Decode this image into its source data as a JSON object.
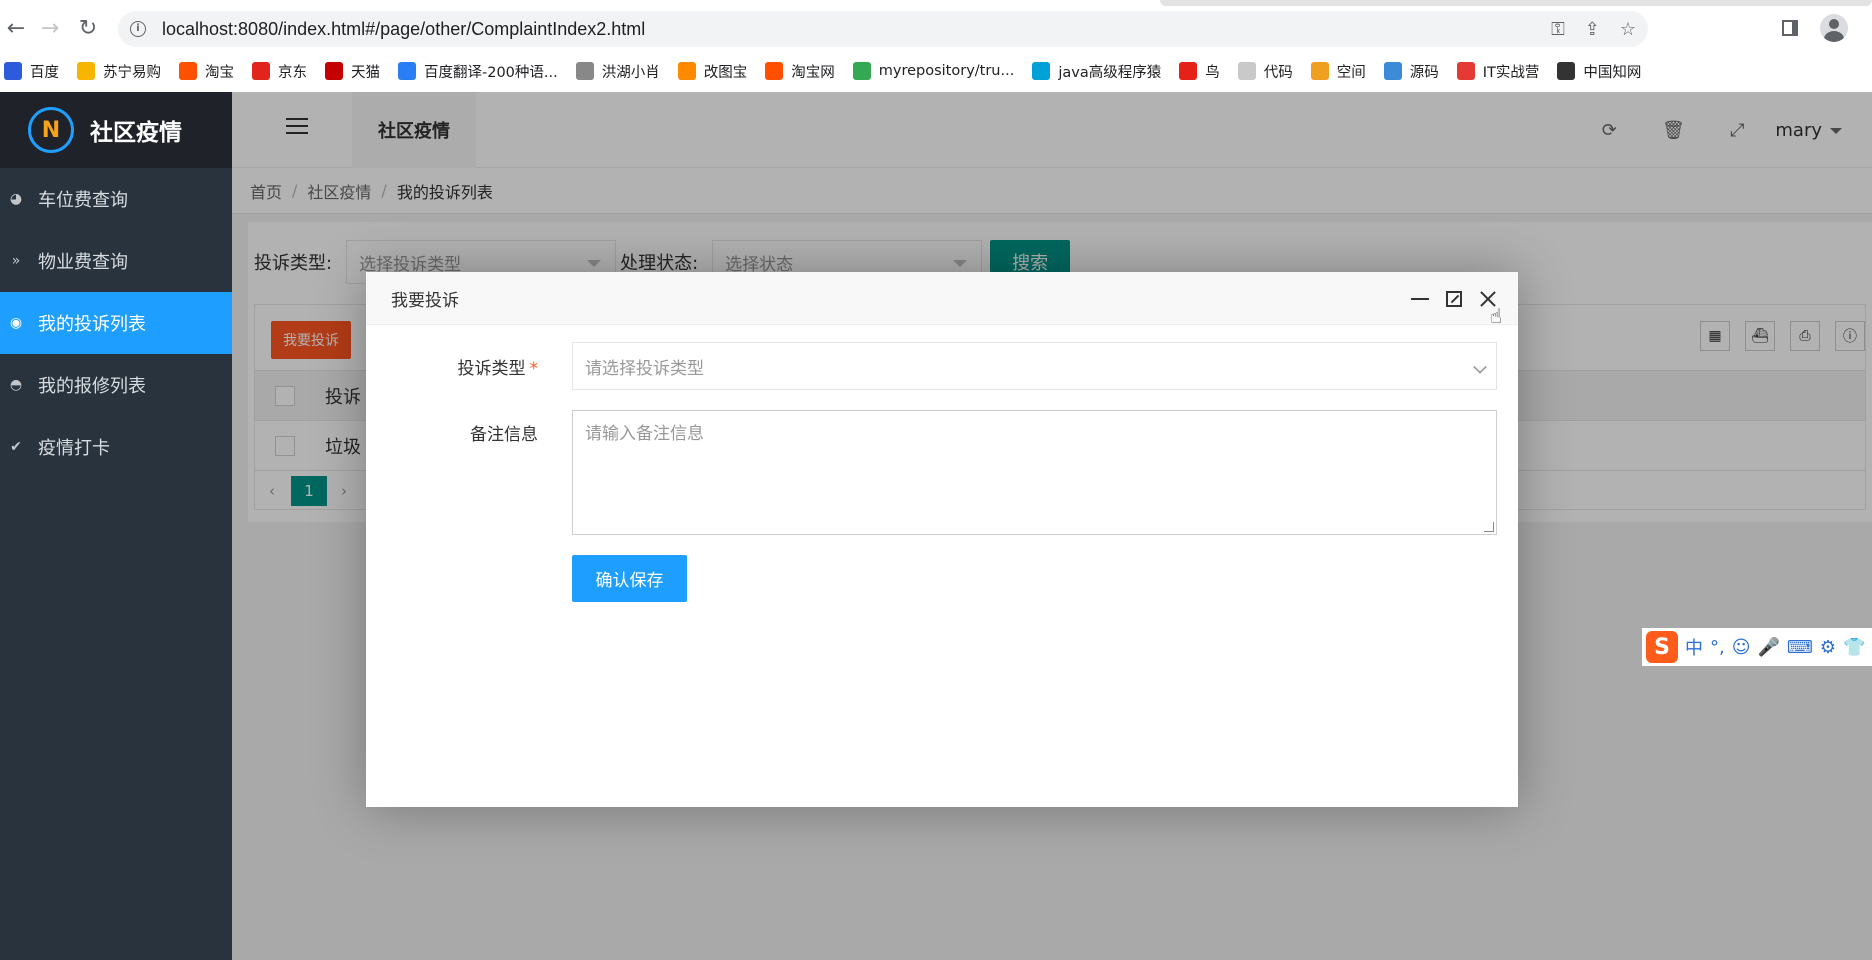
{
  "browser": {
    "url": "localhost:8080/index.html#/page/other/ComplaintIndex2.html",
    "bookmarks": [
      {
        "label": "百度",
        "color": "#2e5bdc",
        "icon": "paw-icon"
      },
      {
        "label": "苏宁易购",
        "color": "#f7b500",
        "icon": "lion-icon"
      },
      {
        "label": "淘宝",
        "color": "#ff5000",
        "icon": "taobao-icon"
      },
      {
        "label": "京东",
        "color": "#e1251b",
        "icon": "jd-icon"
      },
      {
        "label": "天猫",
        "color": "#c40000",
        "icon": "tmall-icon"
      },
      {
        "label": "百度翻译-200种语...",
        "color": "#2a7ef5",
        "icon": "translate-icon"
      },
      {
        "label": "洪湖小肖",
        "color": "#888888",
        "icon": "bird-icon"
      },
      {
        "label": "改图宝",
        "color": "#ff8a00",
        "icon": "image-icon"
      },
      {
        "label": "淘宝网",
        "color": "#ff5000",
        "icon": "taobao-icon"
      },
      {
        "label": "myrepository/tru...",
        "color": "#34a853",
        "icon": "chrome-icon"
      },
      {
        "label": "java高级程序猿",
        "color": "#00a1d6",
        "icon": "tv-icon"
      },
      {
        "label": "鸟",
        "color": "#e62117",
        "icon": "bird-icon"
      },
      {
        "label": "代码",
        "color": "#c9c9c9",
        "icon": "code-icon"
      },
      {
        "label": "空间",
        "color": "#f0a020",
        "icon": "space-icon"
      },
      {
        "label": "源码",
        "color": "#3b8bd9",
        "icon": "fish-icon"
      },
      {
        "label": "IT实战营",
        "color": "#e53935",
        "icon": "target-icon"
      },
      {
        "label": "中国知网",
        "color": "#333333",
        "icon": "cnki-icon"
      }
    ]
  },
  "sidebar": {
    "logo_text": "社区疫情",
    "items": [
      {
        "label": "车位费查询",
        "icon": "dashboard-icon",
        "glyph": "◕",
        "active": false
      },
      {
        "label": "物业费查询",
        "icon": "double-chevron-icon",
        "glyph": "»",
        "active": false
      },
      {
        "label": "我的投诉列表",
        "icon": "radio-icon",
        "glyph": "◉",
        "active": true
      },
      {
        "label": "我的报修列表",
        "icon": "circle-arrow-icon",
        "glyph": "◓",
        "active": false
      },
      {
        "label": "疫情打卡",
        "icon": "check-icon",
        "glyph": "✔",
        "active": false
      }
    ]
  },
  "header": {
    "tab": "社区疫情",
    "user": "mary"
  },
  "breadcrumb": [
    "首页",
    "社区疫情",
    "我的投诉列表"
  ],
  "search": {
    "type_label": "投诉类型:",
    "type_placeholder": "选择投诉类型",
    "status_label": "处理状态:",
    "status_placeholder": "选择状态",
    "button": "搜索"
  },
  "table": {
    "add_button": "我要投诉",
    "header_cell": "投诉",
    "row_cell": "垃圾",
    "page": "1"
  },
  "modal": {
    "title": "我要投诉",
    "type_label": "投诉类型",
    "type_placeholder": "请选择投诉类型",
    "note_label": "备注信息",
    "note_placeholder": "请输入备注信息",
    "save_button": "确认保存"
  },
  "ime": {
    "logo": "S",
    "mode": "中"
  }
}
